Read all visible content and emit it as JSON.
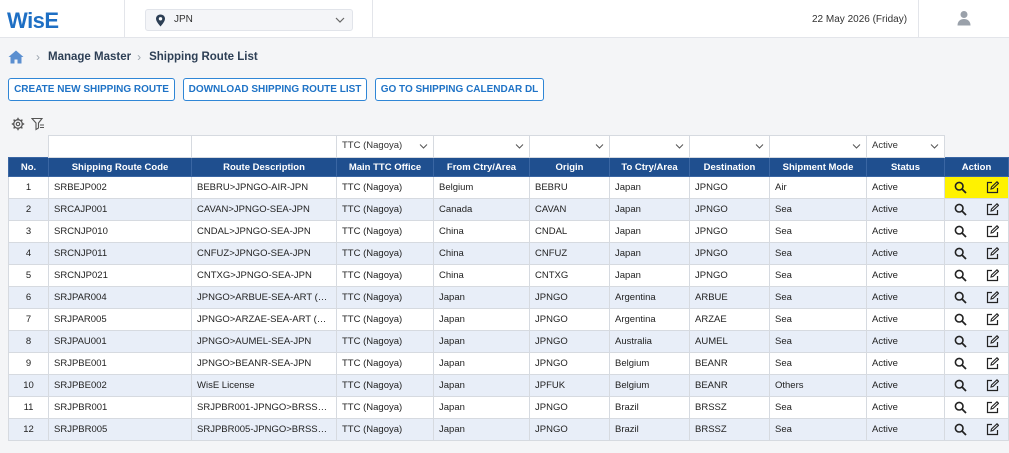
{
  "app": {
    "logo_text": "WisE"
  },
  "header": {
    "region": "JPN",
    "date": "22 May 2026 (Friday)"
  },
  "breadcrumb": {
    "items": [
      "Manage Master",
      "Shipping Route List"
    ]
  },
  "buttons": {
    "create": "CREATE NEW SHIPPING ROUTE",
    "download": "DOWNLOAD SHIPPING ROUTE LIST",
    "calendar": "GO TO SHIPPING CALENDAR DL"
  },
  "filters": {
    "ttc_office": "TTC (Nagoya)",
    "status": "Active"
  },
  "table": {
    "columns": [
      "No.",
      "Shipping Route Code",
      "Route Description",
      "Main TTC Office",
      "From Ctry/Area",
      "Origin",
      "To Ctry/Area",
      "Destination",
      "Shipment Mode",
      "Status",
      "Action"
    ],
    "rows": [
      {
        "no": "1",
        "code": "SRBEJP002",
        "desc": "BEBRU>JPNGO-AIR-JPN",
        "office": "TTC (Nagoya)",
        "from": "Belgium",
        "origin": "BEBRU",
        "to": "Japan",
        "dest": "JPNGO",
        "mode": "Air",
        "status": "Active"
      },
      {
        "no": "2",
        "code": "SRCAJP001",
        "desc": "CAVAN>JPNGO-SEA-JPN",
        "office": "TTC (Nagoya)",
        "from": "Canada",
        "origin": "CAVAN",
        "to": "Japan",
        "dest": "JPNGO",
        "mode": "Sea",
        "status": "Active"
      },
      {
        "no": "3",
        "code": "SRCNJP010",
        "desc": "CNDAL>JPNGO-SEA-JPN",
        "office": "TTC (Nagoya)",
        "from": "China",
        "origin": "CNDAL",
        "to": "Japan",
        "dest": "JPNGO",
        "mode": "Sea",
        "status": "Active"
      },
      {
        "no": "4",
        "code": "SRCNJP011",
        "desc": "CNFUZ>JPNGO-SEA-JPN",
        "office": "TTC (Nagoya)",
        "from": "China",
        "origin": "CNFUZ",
        "to": "Japan",
        "dest": "JPNGO",
        "mode": "Sea",
        "status": "Active"
      },
      {
        "no": "5",
        "code": "SRCNJP021",
        "desc": "CNTXG>JPNGO-SEA-JPN",
        "office": "TTC (Nagoya)",
        "from": "China",
        "origin": "CNTXG",
        "to": "Japan",
        "dest": "JPNGO",
        "mode": "Sea",
        "status": "Active"
      },
      {
        "no": "6",
        "code": "SRJPAR004",
        "desc": "JPNGO>ARBUE-SEA-ART (…",
        "office": "TTC (Nagoya)",
        "from": "Japan",
        "origin": "JPNGO",
        "to": "Argentina",
        "dest": "ARBUE",
        "mode": "Sea",
        "status": "Active"
      },
      {
        "no": "7",
        "code": "SRJPAR005",
        "desc": "JPNGO>ARZAE-SEA-ART (…",
        "office": "TTC (Nagoya)",
        "from": "Japan",
        "origin": "JPNGO",
        "to": "Argentina",
        "dest": "ARZAE",
        "mode": "Sea",
        "status": "Active"
      },
      {
        "no": "8",
        "code": "SRJPAU001",
        "desc": "JPNGO>AUMEL-SEA-JPN",
        "office": "TTC (Nagoya)",
        "from": "Japan",
        "origin": "JPNGO",
        "to": "Australia",
        "dest": "AUMEL",
        "mode": "Sea",
        "status": "Active"
      },
      {
        "no": "9",
        "code": "SRJPBE001",
        "desc": "JPNGO>BEANR-SEA-JPN",
        "office": "TTC (Nagoya)",
        "from": "Japan",
        "origin": "JPNGO",
        "to": "Belgium",
        "dest": "BEANR",
        "mode": "Sea",
        "status": "Active"
      },
      {
        "no": "10",
        "code": "SRJPBE002",
        "desc": "WisE License",
        "office": "TTC (Nagoya)",
        "from": "Japan",
        "origin": "JPFUK",
        "to": "Belgium",
        "dest": "BEANR",
        "mode": "Others",
        "status": "Active"
      },
      {
        "no": "11",
        "code": "SRJPBR001",
        "desc": "SRJPBR001-JPNGO>BRSS…",
        "office": "TTC (Nagoya)",
        "from": "Japan",
        "origin": "JPNGO",
        "to": "Brazil",
        "dest": "BRSSZ",
        "mode": "Sea",
        "status": "Active"
      },
      {
        "no": "12",
        "code": "SRJPBR005",
        "desc": "SRJPBR005-JPNGO>BRSS…",
        "office": "TTC (Nagoya)",
        "from": "Japan",
        "origin": "JPNGO",
        "to": "Brazil",
        "dest": "BRSSZ",
        "mode": "Sea",
        "status": "Active"
      }
    ]
  },
  "colors": {
    "header_bg": "#1f4f8f",
    "accent": "#1f73c6",
    "row_alt": "#e8eef8",
    "highlight": "#fff200"
  },
  "icons": [
    "location-pin-icon",
    "chevron-down-icon",
    "user-icon",
    "home-icon",
    "chevron-right-icon",
    "settings-icon",
    "clear-filter-icon",
    "filter-icon",
    "filter-off-icon",
    "search-icon",
    "edit-icon"
  ]
}
